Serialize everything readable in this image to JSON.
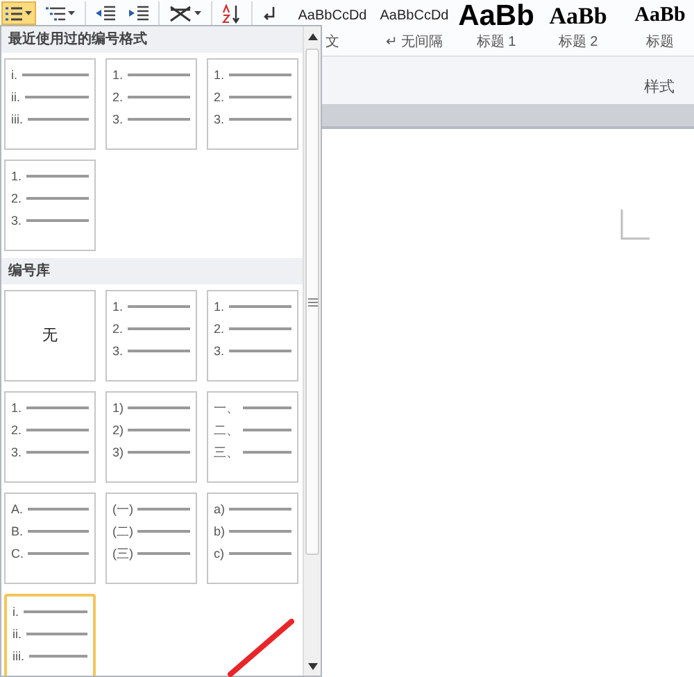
{
  "toolbar": {
    "buttons": [
      {
        "kind": "numbering",
        "selected": true
      },
      {
        "kind": "multilevel",
        "selected": false
      },
      {
        "kind": "outdent",
        "selected": false
      },
      {
        "kind": "indent",
        "selected": false
      },
      {
        "kind": "chinese-layout",
        "selected": false
      },
      {
        "kind": "sort",
        "selected": false
      },
      {
        "kind": "marks",
        "selected": false
      }
    ]
  },
  "styles": {
    "items": [
      {
        "kind": "normal",
        "preview": "AaBbCcDd",
        "label": "文"
      },
      {
        "kind": "normal",
        "preview": "AaBbCcDd",
        "label": "↵ 无间隔"
      },
      {
        "kind": "heading1",
        "preview": "AaBb",
        "label": "标题 1"
      },
      {
        "kind": "heading2",
        "preview": "AaBb",
        "label": "标题 2"
      },
      {
        "kind": "title",
        "preview": "AaBb",
        "label": "标题"
      }
    ],
    "group_label": "样式"
  },
  "numbering_menu": {
    "sections": [
      {
        "title": "最近使用过的编号格式",
        "cards": [
          {
            "kind": "list",
            "markers": [
              "i.",
              "ii.",
              "iii."
            ],
            "selected": false
          },
          {
            "kind": "list",
            "markers": [
              "1.",
              "2.",
              "3."
            ],
            "selected": false
          },
          {
            "kind": "list",
            "markers": [
              "1.",
              "2.",
              "3."
            ],
            "selected": false
          },
          {
            "kind": "list",
            "markers": [
              "1.",
              "2.",
              "3."
            ],
            "selected": false
          }
        ]
      },
      {
        "title": "编号库",
        "cards": [
          {
            "kind": "none",
            "label": "无",
            "selected": false
          },
          {
            "kind": "list",
            "markers": [
              "1.",
              "2.",
              "3."
            ],
            "selected": false
          },
          {
            "kind": "list",
            "markers": [
              "1.",
              "2.",
              "3."
            ],
            "selected": false
          },
          {
            "kind": "list",
            "markers": [
              "1.",
              "2.",
              "3."
            ],
            "selected": false
          },
          {
            "kind": "list",
            "markers": [
              "1)",
              "2)",
              "3)"
            ],
            "selected": false
          },
          {
            "kind": "list",
            "markers": [
              "一、",
              "二、",
              "三、"
            ],
            "selected": false
          },
          {
            "kind": "list",
            "markers": [
              "A.",
              "B.",
              "C."
            ],
            "selected": false
          },
          {
            "kind": "list",
            "markers": [
              "(一)",
              "(二)",
              "(三)"
            ],
            "selected": false
          },
          {
            "kind": "list",
            "markers": [
              "a)",
              "b)",
              "c)"
            ],
            "selected": false
          },
          {
            "kind": "list",
            "markers": [
              "i.",
              "ii.",
              "iii."
            ],
            "selected": true
          }
        ]
      }
    ]
  }
}
